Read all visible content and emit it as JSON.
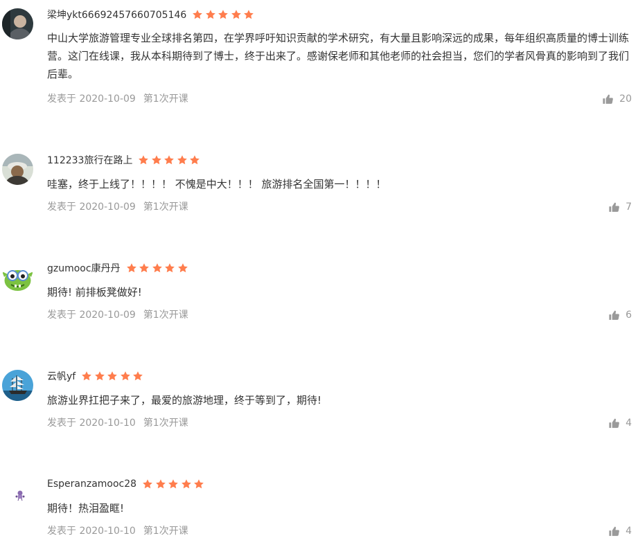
{
  "colors": {
    "star": "#ff7d4d",
    "meta_text": "#999999",
    "body_text": "#333333"
  },
  "comments": [
    {
      "username": "梁坤ykt66692457660705146",
      "rating": 5,
      "text": "中山大学旅游管理专业全球排名第四，在学界呼吁知识贡献的学术研究，有大量且影响深远的成果，每年组织高质量的博士训练营。这门在线课，我从本科期待到了博士，终于出来了。感谢保老师和其他老师的社会担当，您们的学者风骨真的影响到了我们后辈。",
      "date": "发表于 2020-10-09",
      "term": "第1次开课",
      "likes": "20",
      "avatar_icon": "user-photo-avatar"
    },
    {
      "username": "112233旅行在路上",
      "rating": 5,
      "text": "哇塞，终于上线了！！！！ 不愧是中大！！！ 旅游排名全国第一！！！！",
      "date": "发表于 2020-10-09",
      "term": "第1次开课",
      "likes": "7",
      "avatar_icon": "user-photo-avatar"
    },
    {
      "username": "gzumooc康丹丹",
      "rating": 5,
      "text": "期待! 前排板凳做好!",
      "date": "发表于 2020-10-09",
      "term": "第1次开课",
      "likes": "6",
      "avatar_icon": "green-monster-avatar"
    },
    {
      "username": "云帆yf",
      "rating": 5,
      "text": "旅游业界扛把子来了，最爱的旅游地理，终于等到了，期待!",
      "date": "发表于 2020-10-10",
      "term": "第1次开课",
      "likes": "4",
      "avatar_icon": "sailing-ship-avatar"
    },
    {
      "username": "Esperanzamooc28",
      "rating": 5,
      "text": "期待！热泪盈眶!",
      "date": "发表于 2020-10-10",
      "term": "第1次开课",
      "likes": "4",
      "avatar_icon": "small-figure-avatar"
    }
  ]
}
